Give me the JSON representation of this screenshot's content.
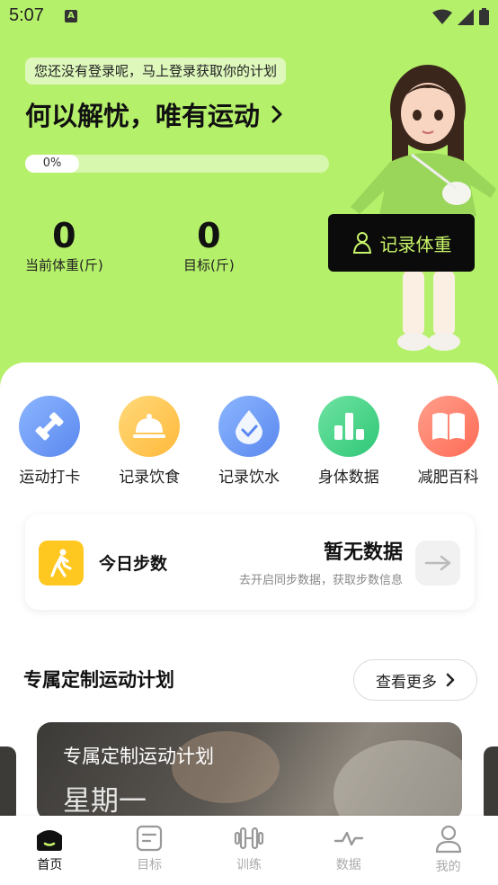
{
  "status_bar": {
    "time": "5:07",
    "notif_icon": "A"
  },
  "hero": {
    "login_tip": "您还没有登录呢，马上登录获取你的计划",
    "slogan": "何以解忧，唯有运动",
    "progress": {
      "value": 0,
      "label": "0%"
    },
    "current_weight": {
      "value": "0",
      "label": "当前体重(斤)"
    },
    "target_weight": {
      "value": "0",
      "label": "目标(斤)"
    },
    "record_weight_label": "记录体重"
  },
  "quick_actions": [
    {
      "label": "运动打卡",
      "icon": "dumbbell-icon",
      "color": "#6a9cf5"
    },
    {
      "label": "记录饮食",
      "icon": "food-cloche-icon",
      "color": "#ffc94a"
    },
    {
      "label": "记录饮水",
      "icon": "water-drop-icon",
      "color": "#6a9cf5"
    },
    {
      "label": "身体数据",
      "icon": "bar-chart-icon",
      "color": "#46d68a"
    },
    {
      "label": "减肥百科",
      "icon": "book-icon",
      "color": "#ff7a66"
    }
  ],
  "steps": {
    "title": "今日步数",
    "value": "暂无数据",
    "subtitle": "去开启同步数据，获取步数信息"
  },
  "plan_section": {
    "title": "专属定制运动计划",
    "more_label": "查看更多",
    "card_title": "专属定制运动计划",
    "card_day": "星期一"
  },
  "tabs": [
    {
      "label": "首页",
      "active": true
    },
    {
      "label": "目标",
      "active": false
    },
    {
      "label": "训练",
      "active": false
    },
    {
      "label": "数据",
      "active": false
    },
    {
      "label": "我的",
      "active": false
    }
  ],
  "colors": {
    "accent": "#b5f06a",
    "button_dark": "#0b0b0b",
    "button_text": "#c9f56a"
  }
}
